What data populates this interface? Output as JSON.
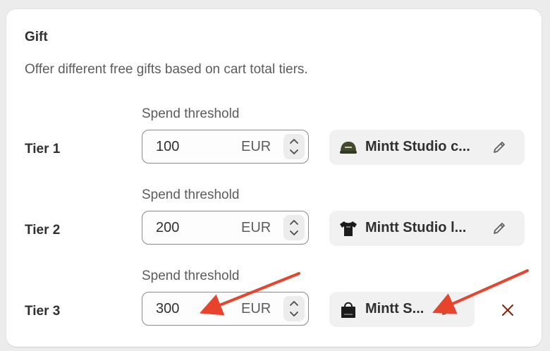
{
  "card": {
    "title": "Gift",
    "subtitle": "Offer different free gifts based on cart total tiers."
  },
  "tiers": [
    {
      "label": "Tier 1",
      "threshold_label": "Spend threshold",
      "amount": "100",
      "currency": "EUR",
      "product_name": "Mintt Studio c...",
      "product_icon": "green-cap-icon"
    },
    {
      "label": "Tier 2",
      "threshold_label": "Spend threshold",
      "amount": "200",
      "currency": "EUR",
      "product_name": "Mintt Studio l...",
      "product_icon": "black-tshirt-icon"
    },
    {
      "label": "Tier 3",
      "threshold_label": "Spend threshold",
      "amount": "300",
      "currency": "EUR",
      "product_name": "Mintt S...",
      "product_icon": "black-tote-bag-icon"
    }
  ],
  "colors": {
    "annotation_arrow": "#e8442d",
    "remove_icon": "#8e1f0b"
  }
}
